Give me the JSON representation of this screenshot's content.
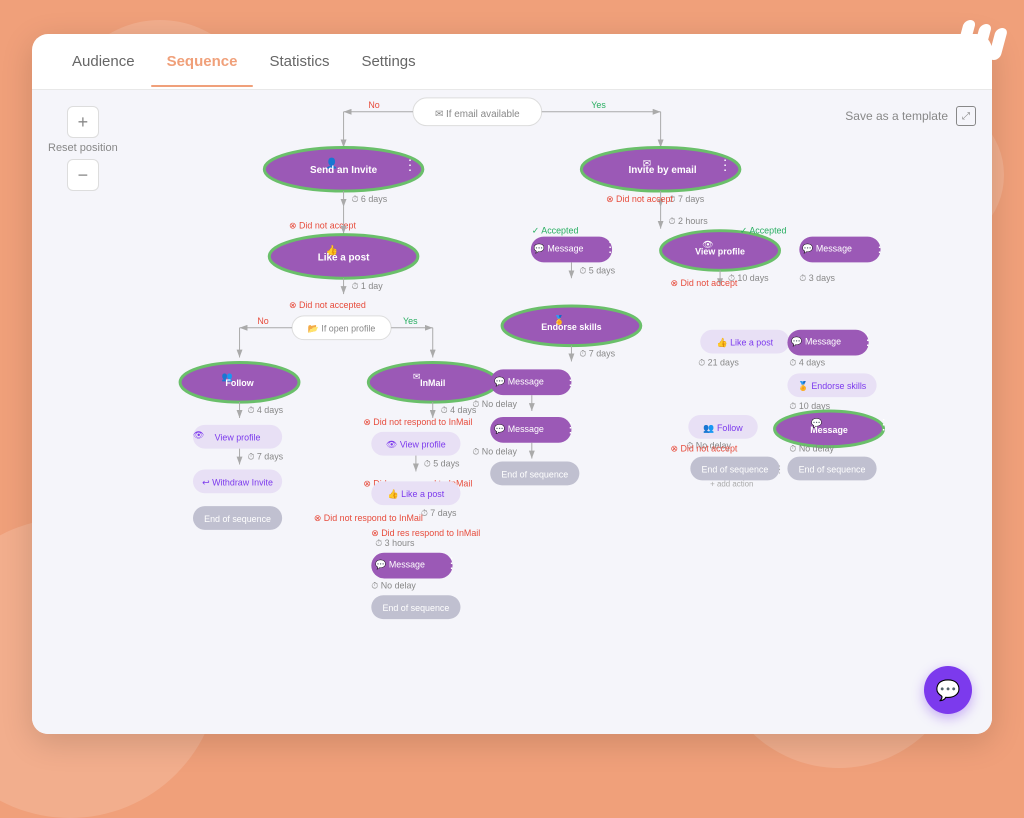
{
  "tabs": [
    {
      "label": "Audience",
      "active": false
    },
    {
      "label": "Sequence",
      "active": true
    },
    {
      "label": "Statistics",
      "active": false
    },
    {
      "label": "Settings",
      "active": false
    }
  ],
  "controls": {
    "reset_label": "Reset position",
    "plus": "+",
    "minus": "−"
  },
  "save_template": "Save as a template",
  "colors": {
    "purple": "#9b59b6",
    "purple_dark": "#7c3aed",
    "green_outline": "#6abf6a",
    "orange": "#f0a07a",
    "gray_node": "#b0b0c0",
    "light_purple": "#c9b3e8"
  }
}
